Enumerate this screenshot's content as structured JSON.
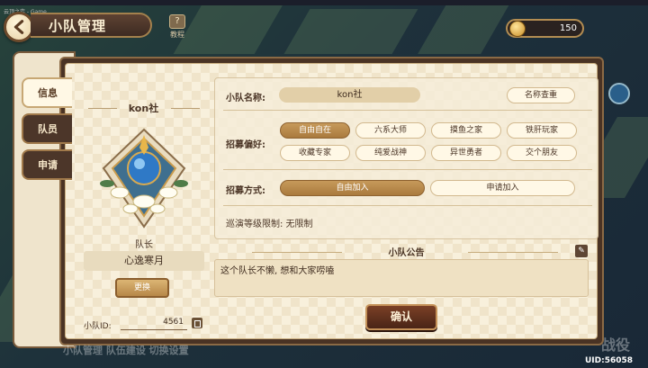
{
  "window": {
    "title": "云顶之弈 - Game"
  },
  "header": {
    "title": "小队管理",
    "tutorial_label": "教程",
    "tutorial_icon": "?",
    "currency_value": "150"
  },
  "tabs": [
    {
      "label": "信息",
      "active": true
    },
    {
      "label": "队员",
      "active": false
    },
    {
      "label": "申请",
      "active": false
    }
  ],
  "team": {
    "name_header": "kon社",
    "role_label": "队长",
    "leader_name": "心逸寒月",
    "change_button": "更换",
    "id_label": "小队ID:",
    "id_value": "4561"
  },
  "settings": {
    "name_label": "小队名称:",
    "name_value": "kon社",
    "name_check_button": "名称查重",
    "pref_label": "招募偏好:",
    "preferences": [
      "自由自在",
      "六系大师",
      "摸鱼之家",
      "铁肝玩家",
      "收藏专家",
      "纯爱战神",
      "异世勇者",
      "交个朋友"
    ],
    "selected_preference": "自由自在",
    "method_label": "招募方式:",
    "methods": [
      "自由加入",
      "申请加入"
    ],
    "selected_method": "自由加入",
    "level_limit": "巡演等级限制: 无限制"
  },
  "notice": {
    "title": "小队公告",
    "text": "这个队长不懒, 想和大家唠嗑",
    "edit_icon": "✎"
  },
  "confirm_button": "确认",
  "footer": {
    "uid": "UID:56058",
    "bottom_left_text": "小队管理 队伍建设 切换设置",
    "bottom_right_text": "战役"
  },
  "colors": {
    "dark_brown": "#4a3324",
    "parchment": "#f8f0dc",
    "selected_pill": "#b48546",
    "gold": "#c59259"
  }
}
